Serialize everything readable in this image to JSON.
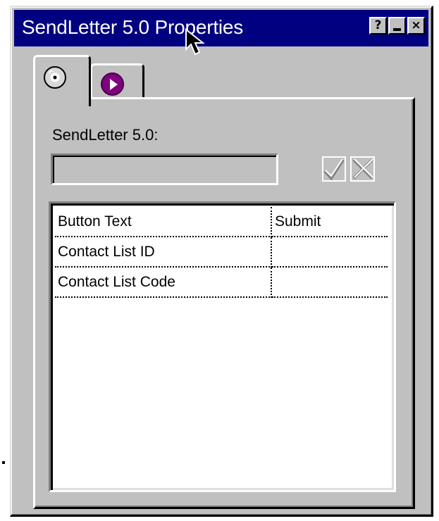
{
  "window": {
    "title": "SendLetter 5.0 Properties",
    "help_label": "?",
    "minimize_icon": "minimize-icon",
    "close_label": "×"
  },
  "tabs": [
    {
      "icon": "cd-icon"
    },
    {
      "icon": "play-icon"
    }
  ],
  "panel": {
    "field_label": "SendLetter 5.0:",
    "field_value": "",
    "confirm_icon": "checkmark-icon",
    "cancel_icon": "x-icon"
  },
  "properties": [
    {
      "name": "Button Text",
      "value": "Submit"
    },
    {
      "name": "Contact List ID",
      "value": ""
    },
    {
      "name": "Contact List Code",
      "value": ""
    }
  ],
  "colors": {
    "titlebar": "#000080",
    "face": "#c0c0c0",
    "play_icon": "#800080"
  }
}
